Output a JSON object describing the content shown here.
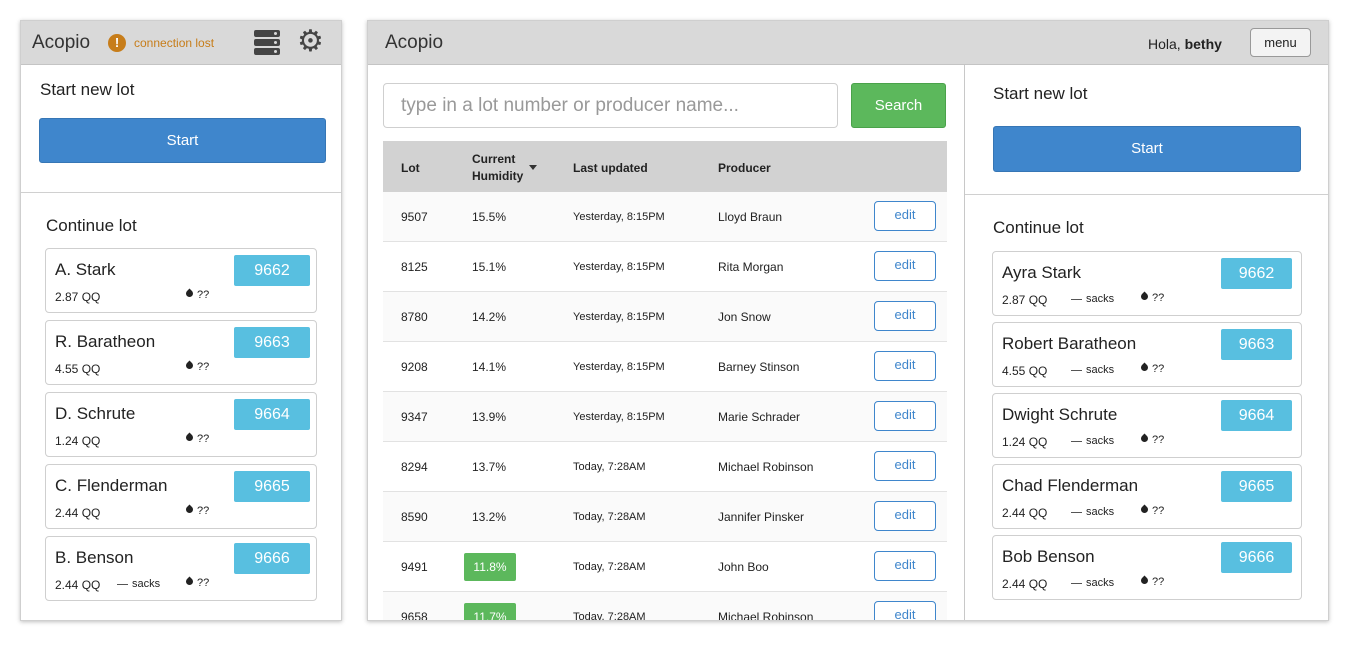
{
  "mobile": {
    "brand": "Acopio",
    "status_icon": "warning-icon",
    "status_icon_glyph": "!",
    "status_text": "connection lost",
    "server_icon": "server-icon",
    "settings_icon": "gear-icon",
    "start_title": "Start new lot",
    "start_button": "Start",
    "continue_title": "Continue lot",
    "lots": [
      {
        "name": "A. Stark",
        "qq": "2.87 QQ",
        "sacks": "",
        "humidity": "??",
        "lot": "9662"
      },
      {
        "name": "R. Baratheon",
        "qq": "4.55 QQ",
        "sacks": "",
        "humidity": "??",
        "lot": "9663"
      },
      {
        "name": "D. Schrute",
        "qq": "1.24 QQ",
        "sacks": "",
        "humidity": "??",
        "lot": "9664"
      },
      {
        "name": "C. Flenderman",
        "qq": "2.44 QQ",
        "sacks": "",
        "humidity": "??",
        "lot": "9665"
      },
      {
        "name": "B. Benson",
        "qq": "2.44 QQ",
        "sacks": "sacks",
        "humidity": "??",
        "lot": "9666"
      }
    ]
  },
  "desktop": {
    "brand": "Acopio",
    "greeting": "Hola,",
    "user": "bethy",
    "menu_button": "menu",
    "search": {
      "placeholder": "type in a lot number or producer name...",
      "value": "",
      "button": "Search"
    },
    "table": {
      "headers": {
        "lot": "Lot",
        "humidity_line1": "Current",
        "humidity_line2": "Humidity",
        "updated": "Last updated",
        "producer": "Producer"
      },
      "sort_icon": "sort-down-icon",
      "edit_label": "edit",
      "rows": [
        {
          "lot": "9507",
          "humidity": "15.5%",
          "updated": "Yesterday, 8:15PM",
          "producer": "Lloyd Braun",
          "highlight": false
        },
        {
          "lot": "8125",
          "humidity": "15.1%",
          "updated": "Yesterday, 8:15PM",
          "producer": "Rita Morgan",
          "highlight": false
        },
        {
          "lot": "8780",
          "humidity": "14.2%",
          "updated": "Yesterday, 8:15PM",
          "producer": "Jon Snow",
          "highlight": false
        },
        {
          "lot": "9208",
          "humidity": "14.1%",
          "updated": "Yesterday, 8:15PM",
          "producer": "Barney Stinson",
          "highlight": false
        },
        {
          "lot": "9347",
          "humidity": "13.9%",
          "updated": "Yesterday, 8:15PM",
          "producer": "Marie Schrader",
          "highlight": false
        },
        {
          "lot": "8294",
          "humidity": "13.7%",
          "updated": "Today, 7:28AM",
          "producer": "Michael Robinson",
          "highlight": false
        },
        {
          "lot": "8590",
          "humidity": "13.2%",
          "updated": "Today, 7:28AM",
          "producer": "Jannifer Pinsker",
          "highlight": false
        },
        {
          "lot": "9491",
          "humidity": "11.8%",
          "updated": "Today, 7:28AM",
          "producer": "John Boo",
          "highlight": true
        },
        {
          "lot": "9658",
          "humidity": "11.7%",
          "updated": "Today, 7:28AM",
          "producer": "Michael Robinson",
          "highlight": true
        }
      ]
    },
    "start_title": "Start new lot",
    "start_button": "Start",
    "continue_title": "Continue lot",
    "lots": [
      {
        "name": "Ayra Stark",
        "qq": "2.87 QQ",
        "sacks": "sacks",
        "humidity": "??",
        "lot": "9662"
      },
      {
        "name": "Robert Baratheon",
        "qq": "4.55 QQ",
        "sacks": "sacks",
        "humidity": "??",
        "lot": "9663"
      },
      {
        "name": "Dwight Schrute",
        "qq": "1.24 QQ",
        "sacks": "sacks",
        "humidity": "??",
        "lot": "9664"
      },
      {
        "name": "Chad Flenderman",
        "qq": "2.44 QQ",
        "sacks": "sacks",
        "humidity": "??",
        "lot": "9665"
      },
      {
        "name": "Bob Benson",
        "qq": "2.44 QQ",
        "sacks": "sacks",
        "humidity": "??",
        "lot": "9666"
      }
    ]
  },
  "colors": {
    "primary": "#3f86cc",
    "success": "#5cb85c",
    "info": "#58bfe0",
    "warning": "#c77d1a"
  }
}
